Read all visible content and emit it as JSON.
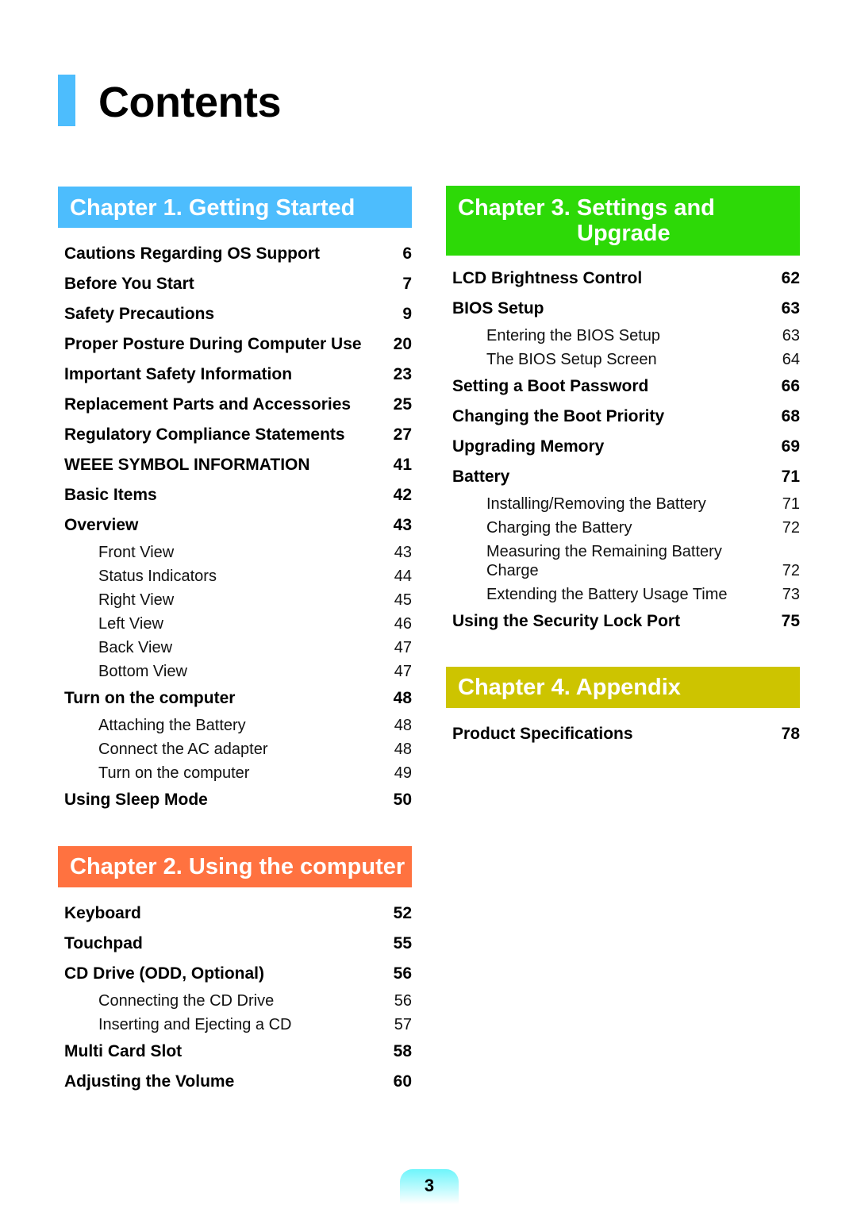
{
  "page_title": "Contents",
  "page_number": "3",
  "colors": {
    "title_accent": "#4dbdfd",
    "chapter1": "#4dbdfd",
    "chapter2": "#ff7240",
    "chapter3": "#2dd907",
    "chapter4": "#cdc400"
  },
  "chapters": [
    {
      "title": "Chapter 1. Getting Started",
      "entries": [
        {
          "label": "Cautions Regarding OS Support",
          "page": "6",
          "level": "main"
        },
        {
          "label": "Before You Start",
          "page": "7",
          "level": "main"
        },
        {
          "label": "Safety Precautions",
          "page": "9",
          "level": "main"
        },
        {
          "label": "Proper Posture During Computer Use",
          "page": "20",
          "level": "main"
        },
        {
          "label": "Important Safety Information",
          "page": "23",
          "level": "main"
        },
        {
          "label": "Replacement Parts and Accessories",
          "page": "25",
          "level": "main"
        },
        {
          "label": "Regulatory Compliance Statements",
          "page": "27",
          "level": "main"
        },
        {
          "label": "WEEE SYMBOL INFORMATION",
          "page": "41",
          "level": "main"
        },
        {
          "label": "Basic Items",
          "page": "42",
          "level": "main"
        },
        {
          "label": "Overview",
          "page": "43",
          "level": "main"
        },
        {
          "label": "Front View",
          "page": "43",
          "level": "sub"
        },
        {
          "label": "Status Indicators",
          "page": "44",
          "level": "sub"
        },
        {
          "label": "Right View",
          "page": "45",
          "level": "sub"
        },
        {
          "label": "Left View",
          "page": "46",
          "level": "sub"
        },
        {
          "label": "Back View",
          "page": "47",
          "level": "sub"
        },
        {
          "label": "Bottom View",
          "page": "47",
          "level": "sub"
        },
        {
          "label": "Turn on the computer",
          "page": "48",
          "level": "main"
        },
        {
          "label": "Attaching the Battery",
          "page": "48",
          "level": "sub"
        },
        {
          "label": "Connect the AC adapter",
          "page": "48",
          "level": "sub"
        },
        {
          "label": "Turn on the computer",
          "page": "49",
          "level": "sub"
        },
        {
          "label": "Using Sleep Mode",
          "page": "50",
          "level": "main"
        }
      ]
    },
    {
      "title": "Chapter 2. Using the computer",
      "entries": [
        {
          "label": "Keyboard",
          "page": "52",
          "level": "main"
        },
        {
          "label": "Touchpad",
          "page": "55",
          "level": "main"
        },
        {
          "label": "CD Drive (ODD, Optional)",
          "page": "56",
          "level": "main"
        },
        {
          "label": "Connecting the CD Drive",
          "page": "56",
          "level": "sub"
        },
        {
          "label": "Inserting and Ejecting a CD",
          "page": "57",
          "level": "sub"
        },
        {
          "label": "Multi Card Slot",
          "page": "58",
          "level": "main"
        },
        {
          "label": "Adjusting the Volume",
          "page": "60",
          "level": "main"
        }
      ]
    },
    {
      "title_line1": "Chapter 3. Settings and",
      "title_line2": "Upgrade",
      "entries": [
        {
          "label": "LCD Brightness Control",
          "page": "62",
          "level": "main"
        },
        {
          "label": "BIOS Setup",
          "page": "63",
          "level": "main"
        },
        {
          "label": "Entering the BIOS Setup",
          "page": "63",
          "level": "sub"
        },
        {
          "label": "The BIOS Setup Screen",
          "page": "64",
          "level": "sub"
        },
        {
          "label": "Setting a Boot Password",
          "page": "66",
          "level": "main"
        },
        {
          "label": "Changing the Boot Priority",
          "page": "68",
          "level": "main"
        },
        {
          "label": "Upgrading Memory",
          "page": "69",
          "level": "main"
        },
        {
          "label": "Battery",
          "page": "71",
          "level": "main"
        },
        {
          "label": "Installing/Removing the Battery",
          "page": "71",
          "level": "sub"
        },
        {
          "label": "Charging the Battery",
          "page": "72",
          "level": "sub"
        },
        {
          "label": "Measuring the Remaining Battery Charge",
          "page": "72",
          "level": "sub multi"
        },
        {
          "label": "Extending the Battery Usage Time",
          "page": "73",
          "level": "sub"
        },
        {
          "label": "Using the Security Lock Port",
          "page": "75",
          "level": "main"
        }
      ]
    },
    {
      "title": "Chapter 4. Appendix",
      "entries": [
        {
          "label": "Product Specifications",
          "page": "78",
          "level": "main"
        }
      ]
    }
  ]
}
